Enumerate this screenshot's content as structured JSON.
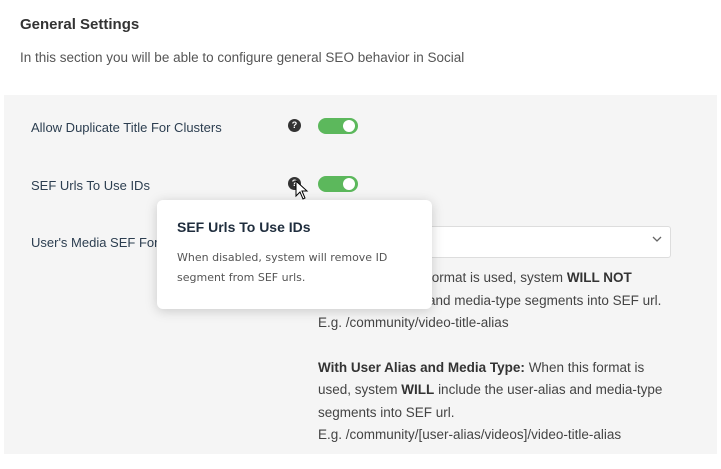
{
  "header": {
    "title": "General Settings",
    "description": "In this section you will be able to configure general SEO behavior in Social"
  },
  "settings": [
    {
      "label": "Allow Duplicate Title For Clusters",
      "help_icon": "question-circle-icon",
      "enabled": true
    },
    {
      "label": "SEF Urls To Use IDs",
      "help_icon": "question-circle-icon",
      "enabled": true
    },
    {
      "label": "User's Media SEF Form"
    }
  ],
  "media_format": {
    "selected_value": "",
    "description_line1_tail": "format is used, system",
    "description_line1_bold": "WILL NOT",
    "description_line2": "and media-type segments into SEF url.",
    "example1": "E.g. /community/video-title-alias",
    "with_alias_title": "With User Alias and Media Type:",
    "with_alias_text_a": "When this format is used, system",
    "with_alias_bold": "WILL",
    "with_alias_text_b": "include the user-alias and media-type segments into SEF url.",
    "example2": "E.g. /community/[user-alias/videos]/video-title-alias"
  },
  "tooltip": {
    "title": "SEF Urls To Use IDs",
    "body": "When disabled, system will remove ID segment from SEF urls."
  },
  "colors": {
    "toggle_on": "#5cb85c",
    "panel_bg": "#f5f5f5"
  }
}
